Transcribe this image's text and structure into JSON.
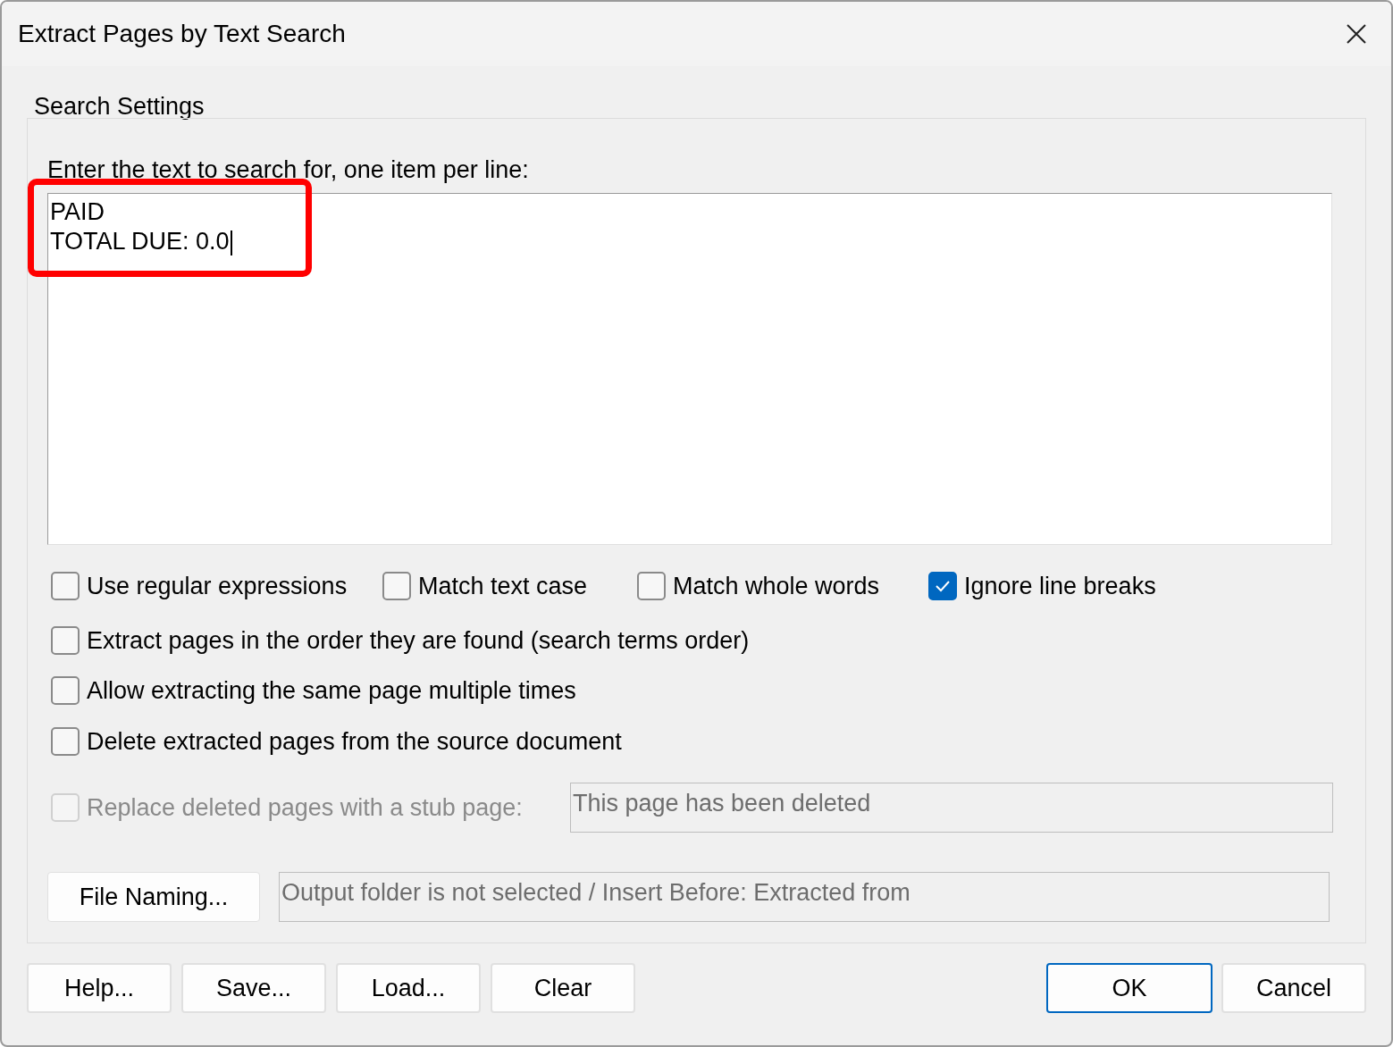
{
  "window": {
    "title": "Extract Pages by Text Search"
  },
  "group": {
    "title": "Search Settings"
  },
  "search": {
    "label": "Enter the text to search for, one item per line:",
    "lines": [
      "PAID",
      "TOTAL DUE: 0.0"
    ],
    "highlighted": true
  },
  "options_row": [
    {
      "label": "Use regular expressions",
      "checked": false
    },
    {
      "label": "Match text case",
      "checked": false
    },
    {
      "label": "Match whole words",
      "checked": false
    },
    {
      "label": "Ignore line breaks",
      "checked": true
    }
  ],
  "options": [
    {
      "label": "Extract pages in the order they are found (search terms order)",
      "checked": false
    },
    {
      "label": "Allow extracting the same page multiple times",
      "checked": false
    },
    {
      "label": "Delete extracted pages from the source document",
      "checked": false
    }
  ],
  "stub": {
    "label": "Replace deleted pages with a stub page:",
    "checked": false,
    "disabled": true,
    "value": "This page has been deleted"
  },
  "file_naming": {
    "button": "File Naming...",
    "value": "Output folder is not selected / Insert Before: Extracted from"
  },
  "left_buttons": [
    {
      "label": "Help...",
      "default": false
    },
    {
      "label": "Save...",
      "default": false
    },
    {
      "label": "Load...",
      "default": false
    },
    {
      "label": "Clear",
      "default": false
    }
  ],
  "right_buttons": [
    {
      "label": "OK",
      "default": true
    },
    {
      "label": "Cancel",
      "default": false
    }
  ]
}
